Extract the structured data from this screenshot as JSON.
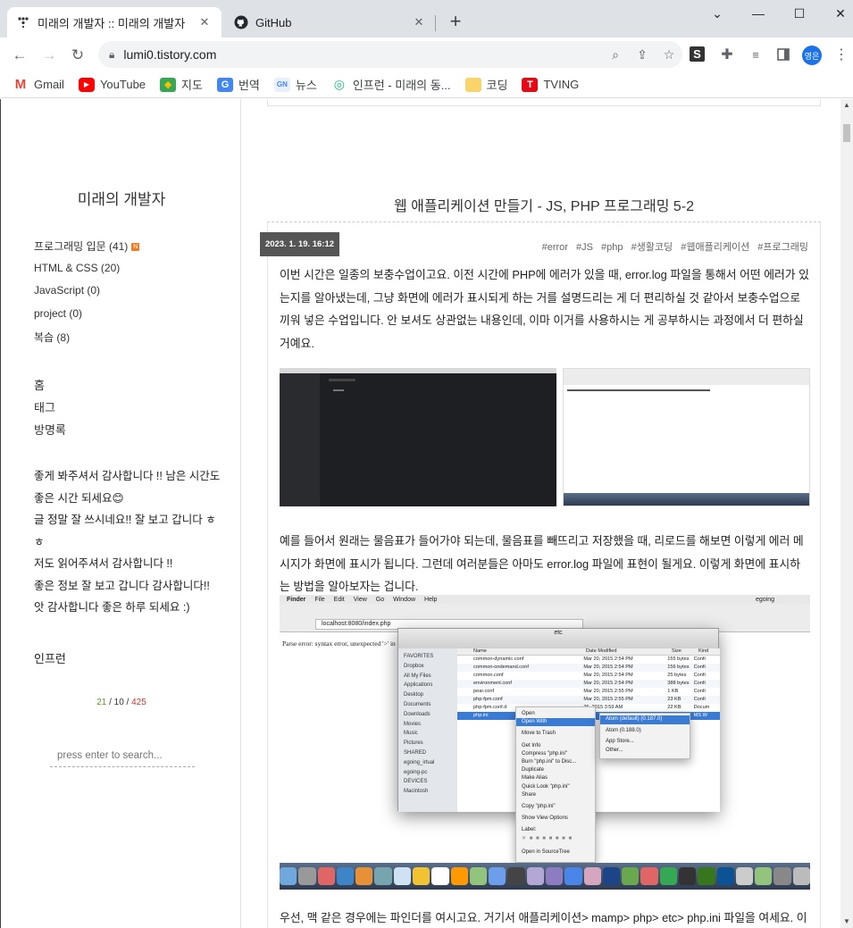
{
  "browser": {
    "tabs": [
      {
        "title": "미래의 개발자 :: 미래의 개발자",
        "active": true
      },
      {
        "title": "GitHub",
        "active": false
      }
    ],
    "url": "lumi0.tistory.com",
    "profile_initials": "영은",
    "bookmarks": [
      {
        "label": "Gmail",
        "icon": "gmail-icon",
        "color": "#ea4335"
      },
      {
        "label": "YouTube",
        "icon": "youtube-icon",
        "color": "#ff0000"
      },
      {
        "label": "지도",
        "icon": "maps-icon",
        "color": "#34a853"
      },
      {
        "label": "번역",
        "icon": "translate-icon",
        "color": "#4285f4"
      },
      {
        "label": "뉴스",
        "icon": "news-icon",
        "color": "#4285f4"
      },
      {
        "label": "인프런 - 미래의 동...",
        "icon": "inflearn-icon",
        "color": "#1dc078"
      },
      {
        "label": "코딩",
        "icon": "folder-icon",
        "color": "#f9d46a"
      },
      {
        "label": "TVING",
        "icon": "tving-icon",
        "color": "#e50914"
      }
    ]
  },
  "sidebar": {
    "blog_title": "미래의 개발자",
    "categories": [
      {
        "label": "프로그래밍 입문 (41)",
        "new": true
      },
      {
        "label": "HTML & CSS (20)",
        "new": false
      },
      {
        "label": "JavaScript (0)",
        "new": false
      },
      {
        "label": "project (0)",
        "new": false
      },
      {
        "label": "복습 (8)",
        "new": false
      }
    ],
    "nav": [
      "홈",
      "태그",
      "방명록"
    ],
    "recent_comments": [
      "좋게 봐주셔서 감사합니다 !! 남은 시간도 좋은 시간 되세요😊",
      "글 정말 잘 쓰시네요!! 잘 보고 갑니다 ㅎㅎ",
      "저도 읽어주셔서 감사합니다 !!",
      "좋은 정보 잘 보고 갑니다 감사합니다!!",
      "앗 감사합니다 좋은 하루 되세요 :)"
    ],
    "inflearn_label": "인프런",
    "counter": {
      "today": "21",
      "yesterday": "10",
      "total": "425"
    },
    "search_placeholder": "press enter to search..."
  },
  "post": {
    "title": "웹 애플리케이션 만들기 - JS, PHP 프로그래밍 5-2",
    "date": "2023. 1. 19. 16:12",
    "tags": [
      "#error",
      "#JS",
      "#php",
      "#생활코딩",
      "#웹애플리케이션",
      "#프로그래밍"
    ],
    "paragraphs": [
      "이번 시간은 일종의 보충수업이고요. 이전 시간에 PHP에 에러가 있을 때, error.log 파일을 통해서 어떤 에러가 있는지를 알아냈는데, 그냥 화면에 에러가 표시되게 하는 거를 설명드리는 게 더 편리하실 것 같아서 보충수업으로 끼워 넣은 수업입니다. 안 보셔도 상관없는 내용인데, 이마 이거를 사용하시는 게 공부하시는 과정에서 더 편하실 거예요.",
      "예를 들어서 원래는 물음표가 들어가야 되는데, 물음표를 빼뜨리고 저장했을 때, 리로드를 해보면 이렇게 에러 메시지가 화면에 표시가 됩니다. 그런데 여러분들은 아마도 error.log 파일에 표현이 될게요. 이렇게 화면에 표시하는 방법을 알아보자는 겁니다.",
      "우선, 맥 같은 경우에는 파인더를 여시고요. 거기서 애플리케이션> mamp> php> etc> php.ini 파일을 여세요. 이"
    ],
    "screenshot_texts": {
      "menu": [
        "Finder",
        "File",
        "Edit",
        "View",
        "Go",
        "Window",
        "Help"
      ],
      "user": "egoing",
      "address": "localhost:8080/index.php",
      "parse_error": "Parse error: syntax error, unexpected '>' in",
      "folder": "etc",
      "columns": [
        "Name",
        "Date Modified",
        "Size",
        "Kind"
      ],
      "files": [
        [
          "common-dynamic.conf",
          "Mar 20, 2015 2:54 PM",
          "155 bytes",
          "Confi"
        ],
        [
          "common-ondemand.conf",
          "Mar 20, 2015 2:54 PM",
          "156 bytes",
          "Confi"
        ],
        [
          "common.conf",
          "Mar 20, 2015 2:54 PM",
          "25 bytes",
          "Confi"
        ],
        [
          "environment.conf",
          "Mar 20, 2015 2:54 PM",
          "388 bytes",
          "Confi"
        ],
        [
          "pear.conf",
          "Mar 20, 2015 2:55 PM",
          "1 KB",
          "Confi"
        ],
        [
          "php-fpm.conf",
          "Mar 20, 2015 2:55 PM",
          "23 KB",
          "Confi"
        ],
        [
          "php-fpm.conf.d",
          "26, 2015 3:59 AM",
          "22 KB",
          "Docum"
        ],
        [
          "php.ini",
          "",
          "",
          "MS W"
        ]
      ],
      "favorites": [
        "FAVORITES",
        "Dropbox",
        "All My Files",
        "Applications",
        "Desktop",
        "Documents",
        "Downloads",
        "Movies",
        "Music",
        "Pictures",
        "SHARED",
        "egoing_irtual",
        "egoing-pc",
        "DEVICES",
        "Macintosh"
      ],
      "context_menu": [
        "Open",
        "Open With",
        "Move to Trash",
        "Get Info",
        "Compress \"php.ini\"",
        "Burn \"php.ini\" to Disc...",
        "Duplicate",
        "Make Alias",
        "Quick Look \"php.ini\"",
        "Share",
        "Copy \"php.ini\"",
        "Show View Options",
        "Label:",
        "Open in SourceTree"
      ],
      "open_with": [
        "Atom (default) (0.187.0)",
        "Atom (0.188.0)",
        "App Store...",
        "Other..."
      ]
    }
  }
}
